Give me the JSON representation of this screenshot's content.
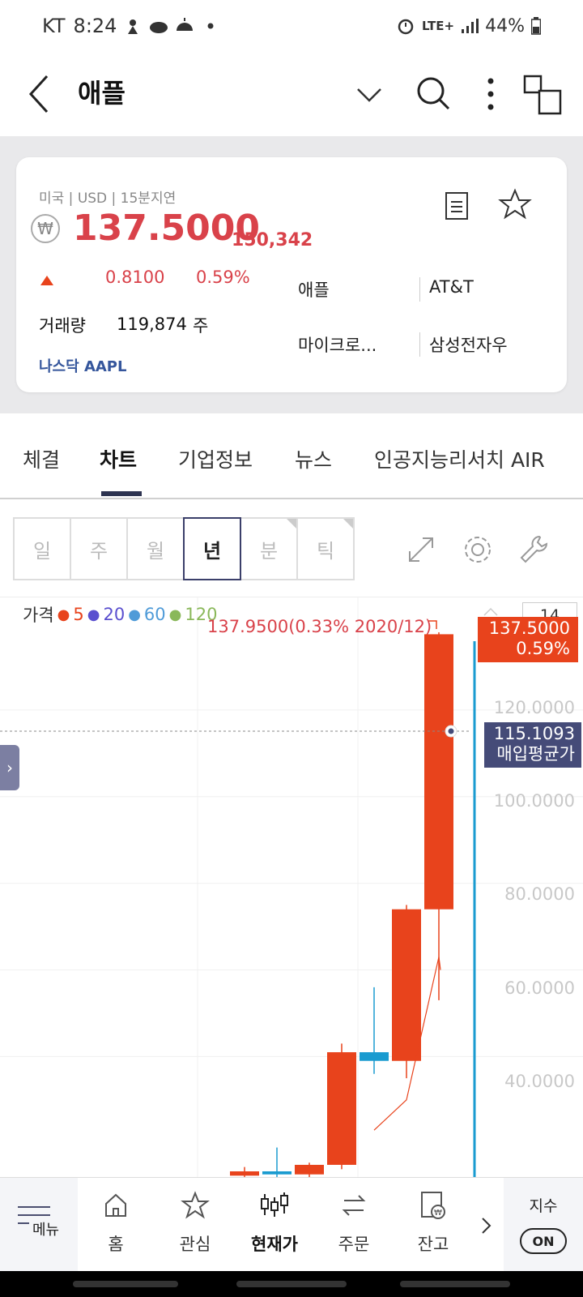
{
  "status": {
    "carrier": "KT",
    "time": "8:24",
    "network": "LTE+",
    "battery": "44%"
  },
  "header": {
    "title": "애플"
  },
  "quote": {
    "market_info": "미국 | USD | 15분지연",
    "currency_symbol": "₩",
    "price": "137.5000",
    "price_krw": "150,342",
    "change": "0.8100",
    "change_pct": "0.59%",
    "volume_label": "거래량",
    "volume": "119,874",
    "volume_unit": "주",
    "exchange": "나스닥 AAPL",
    "related": [
      "애플",
      "AT&T",
      "마이크로...",
      "삼성전자우"
    ]
  },
  "tabs": [
    {
      "label": "체결"
    },
    {
      "label": "차트"
    },
    {
      "label": "기업정보"
    },
    {
      "label": "뉴스"
    },
    {
      "label": "인공지능리서치 AIR"
    }
  ],
  "periods": [
    "일",
    "주",
    "월",
    "년",
    "분",
    "틱"
  ],
  "chart_data": {
    "type": "candlestick",
    "legend_label": "가격",
    "ma_periods": [
      {
        "name": "5",
        "color": "#e8431c"
      },
      {
        "name": "20",
        "color": "#5a4fcf"
      },
      {
        "name": "60",
        "color": "#4f9bd8"
      },
      {
        "name": "120",
        "color": "#8ab85a"
      }
    ],
    "y_ticks": [
      "120.0000",
      "100.0000",
      "80.0000",
      "60.0000",
      "40.0000"
    ],
    "ylim": [
      12,
      146
    ],
    "zoom": "14",
    "high_label": "137.9500(0.33% 2020/12)",
    "last_price": "137.5000",
    "last_pct": "0.59%",
    "avg_price": "115.1093",
    "avg_label": "매입평균가",
    "up_color": "#e8431c",
    "down_color": "#1a9bd0",
    "candles": [
      {
        "open": 12.5,
        "high": 14.5,
        "low": 12.0,
        "close": 13.5,
        "dir": "up"
      },
      {
        "open": 13.5,
        "high": 19.0,
        "low": 12.0,
        "close": 12.8,
        "dir": "down"
      },
      {
        "open": 12.8,
        "high": 15.5,
        "low": 12.0,
        "close": 15.0,
        "dir": "up"
      },
      {
        "open": 15.0,
        "high": 43.0,
        "low": 14.0,
        "close": 41.0,
        "dir": "up"
      },
      {
        "open": 41.0,
        "high": 56.0,
        "low": 36.0,
        "close": 39.0,
        "dir": "down"
      },
      {
        "open": 39.0,
        "high": 75.0,
        "low": 35.0,
        "close": 74.0,
        "dir": "up"
      },
      {
        "open": 74.0,
        "high": 137.95,
        "low": 53.0,
        "close": 137.5,
        "dir": "up"
      }
    ],
    "ma5": [
      null,
      null,
      null,
      null,
      23.0,
      30.0,
      63.0
    ]
  },
  "bottom_nav": {
    "menu": "메뉴",
    "items": [
      "홈",
      "관심",
      "현재가",
      "주문",
      "잔고"
    ],
    "index_label": "지수",
    "index_state": "ON"
  }
}
